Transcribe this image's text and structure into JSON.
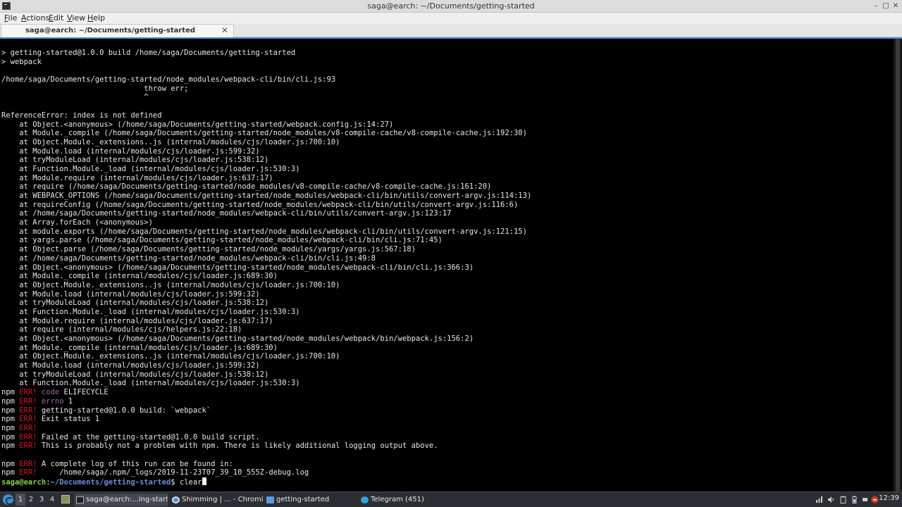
{
  "window": {
    "title": "saga@earch: ~/Documents/getting-started",
    "minimize": "–",
    "maximize": "□",
    "close": "✕"
  },
  "menu": {
    "file": {
      "first": "F",
      "rest": "ile"
    },
    "actions": {
      "first": "A",
      "rest": "ctions"
    },
    "edit": {
      "first": "E",
      "rest": "dit"
    },
    "view": {
      "first": "V",
      "rest": "iew"
    },
    "help": {
      "first": "H",
      "rest": "elp"
    }
  },
  "tab": {
    "label": "saga@earch: ~/Documents/getting-started",
    "close": "✕"
  },
  "terminal": {
    "lines": [
      "> getting-started@1.0.0 build /home/saga/Documents/getting-started",
      "> webpack",
      "",
      "/home/saga/Documents/getting-started/node_modules/webpack-cli/bin/cli.js:93",
      "                                throw err;",
      "                                ^",
      "",
      "ReferenceError: index is not defined",
      "    at Object.<anonymous> (/home/saga/Documents/getting-started/webpack.config.js:14:27)",
      "    at Module._compile (/home/saga/Documents/getting-started/node_modules/v8-compile-cache/v8-compile-cache.js:192:30)",
      "    at Object.Module._extensions..js (internal/modules/cjs/loader.js:700:10)",
      "    at Module.load (internal/modules/cjs/loader.js:599:32)",
      "    at tryModuleLoad (internal/modules/cjs/loader.js:538:12)",
      "    at Function.Module._load (internal/modules/cjs/loader.js:530:3)",
      "    at Module.require (internal/modules/cjs/loader.js:637:17)",
      "    at require (/home/saga/Documents/getting-started/node_modules/v8-compile-cache/v8-compile-cache.js:161:20)",
      "    at WEBPACK_OPTIONS (/home/saga/Documents/getting-started/node_modules/webpack-cli/bin/utils/convert-argv.js:114:13)",
      "    at requireConfig (/home/saga/Documents/getting-started/node_modules/webpack-cli/bin/utils/convert-argv.js:116:6)",
      "    at /home/saga/Documents/getting-started/node_modules/webpack-cli/bin/utils/convert-argv.js:123:17",
      "    at Array.forEach (<anonymous>)",
      "    at module.exports (/home/saga/Documents/getting-started/node_modules/webpack-cli/bin/utils/convert-argv.js:121:15)",
      "    at yargs.parse (/home/saga/Documents/getting-started/node_modules/webpack-cli/bin/cli.js:71:45)",
      "    at Object.parse (/home/saga/Documents/getting-started/node_modules/yargs/yargs.js:567:18)",
      "    at /home/saga/Documents/getting-started/node_modules/webpack-cli/bin/cli.js:49:8",
      "    at Object.<anonymous> (/home/saga/Documents/getting-started/node_modules/webpack-cli/bin/cli.js:366:3)",
      "    at Module._compile (internal/modules/cjs/loader.js:689:30)",
      "    at Object.Module._extensions..js (internal/modules/cjs/loader.js:700:10)",
      "    at Module.load (internal/modules/cjs/loader.js:599:32)",
      "    at tryModuleLoad (internal/modules/cjs/loader.js:538:12)",
      "    at Function.Module._load (internal/modules/cjs/loader.js:530:3)",
      "    at Module.require (internal/modules/cjs/loader.js:637:17)",
      "    at require (internal/modules/cjs/helpers.js:22:18)",
      "    at Object.<anonymous> (/home/saga/Documents/getting-started/node_modules/webpack/bin/webpack.js:156:2)",
      "    at Module._compile (internal/modules/cjs/loader.js:689:30)",
      "    at Object.Module._extensions..js (internal/modules/cjs/loader.js:700:10)",
      "    at Module.load (internal/modules/cjs/loader.js:599:32)",
      "    at tryModuleLoad (internal/modules/cjs/loader.js:538:12)",
      "    at Function.Module._load (internal/modules/cjs/loader.js:530:3)"
    ],
    "npm_lines": [
      {
        "prefix": "npm",
        "tag": "ERR!",
        "key": "code",
        "text": " ELIFECYCLE"
      },
      {
        "prefix": "npm",
        "tag": "ERR!",
        "key": "errno",
        "text": " 1"
      },
      {
        "prefix": "npm",
        "tag": "ERR!",
        "key": "",
        "text": " getting-started@1.0.0 build: `webpack`"
      },
      {
        "prefix": "npm",
        "tag": "ERR!",
        "key": "",
        "text": " Exit status 1"
      },
      {
        "prefix": "npm",
        "tag": "ERR!",
        "key": "",
        "text": ""
      },
      {
        "prefix": "npm",
        "tag": "ERR!",
        "key": "",
        "text": " Failed at the getting-started@1.0.0 build script."
      },
      {
        "prefix": "npm",
        "tag": "ERR!",
        "key": "",
        "text": " This is probably not a problem with npm. There is likely additional logging output above."
      },
      {
        "blank": true
      },
      {
        "prefix": "npm",
        "tag": "ERR!",
        "key": "",
        "text": " A complete log of this run can be found in:"
      },
      {
        "prefix": "npm",
        "tag": "ERR!",
        "key": "",
        "text": "     /home/saga/.npm/_logs/2019-11-23T07_39_10_555Z-debug.log"
      }
    ],
    "prompt": {
      "user": "saga@earch",
      "sep": ":",
      "path": "~/Documents/getting-started",
      "symbol": "$",
      "command": " clear"
    }
  },
  "taskbar": {
    "workspaces": [
      "1",
      "2",
      "3",
      "4"
    ],
    "tasks": [
      {
        "label": "saga@earch:...ing-started",
        "icon": "terminal-icon"
      },
      {
        "label": "Shimming | ... - Chromium",
        "icon": "chromium-icon"
      },
      {
        "label": "getting-started",
        "icon": "folder-icon"
      },
      {
        "label": "Telegram (451)",
        "icon": "telegram-icon"
      }
    ],
    "clock": "12:39"
  }
}
